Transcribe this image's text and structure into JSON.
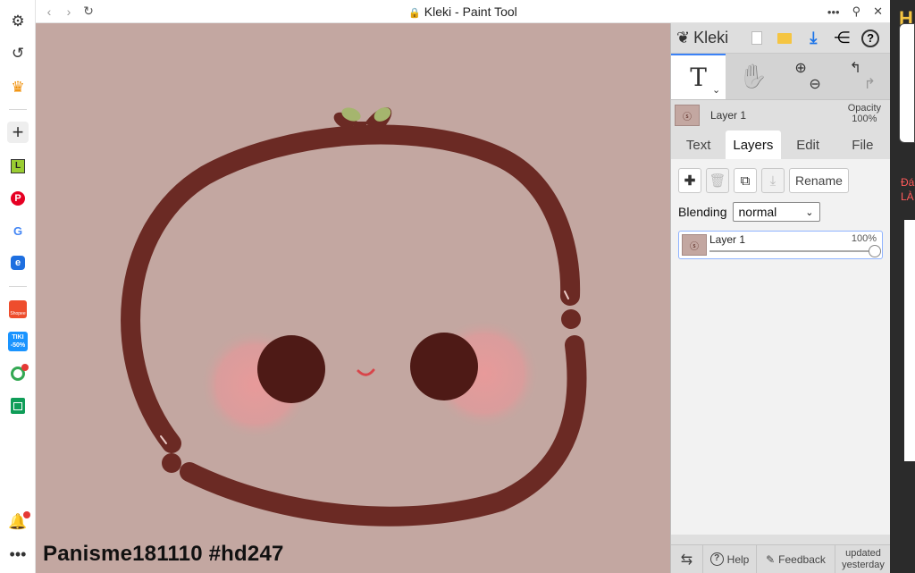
{
  "browser": {
    "page_title": "Kleki - Paint Tool",
    "sidebar_icons": [
      "gear-icon",
      "history-icon",
      "crown-icon",
      "plus-icon",
      "l-app-icon",
      "pinterest-icon",
      "google-icon",
      "edge-icon",
      "shopee-icon",
      "tiki-icon",
      "maps-icon",
      "sheets-icon",
      "bell-icon",
      "more-icon"
    ],
    "tiki_label": "TIKI -50%",
    "shopee_label": "Shopee"
  },
  "canvas": {
    "background": "#c3a7a1",
    "watermark": "Panisme181110 #hd247"
  },
  "app": {
    "logo_text": "Kleki",
    "tools": {
      "text_glyph": "T",
      "hand_glyph": "✋"
    },
    "current_layer": {
      "name": "Layer 1",
      "opacity_label": "Opacity",
      "opacity_value": "100%"
    },
    "tabs": [
      "Text",
      "Layers",
      "Edit",
      "File"
    ],
    "active_tab": "Layers",
    "rename_label": "Rename",
    "blending_label": "Blending",
    "blending_value": "normal",
    "layer_card": {
      "name": "Layer 1",
      "opacity": "100%",
      "opacity_fraction": 1.0
    },
    "footer": {
      "help": "Help",
      "feedback": "Feedback",
      "updated": "updated yesterday"
    }
  },
  "strip": {
    "red_text": "Đá LÀ"
  }
}
